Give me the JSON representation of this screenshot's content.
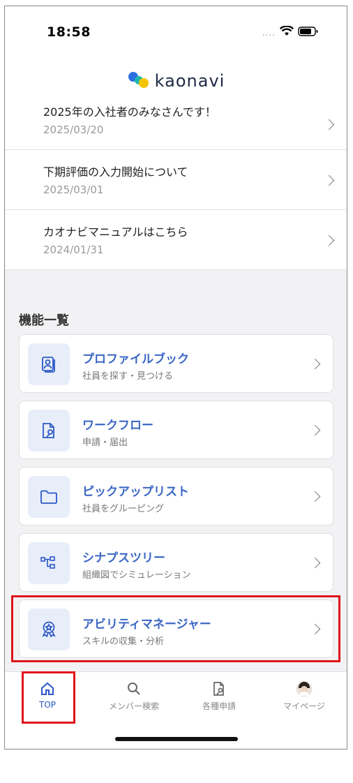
{
  "status_bar": {
    "time": "18:58",
    "signal": "....",
    "wifi_icon": "wifi-icon",
    "battery_icon": "battery-icon"
  },
  "header": {
    "logo_text": "kaonavi"
  },
  "news": [
    {
      "title": "2025年の入社者のみなさんです！",
      "date": "2025/03/20"
    },
    {
      "title": "下期評価の入力開始について",
      "date": "2025/03/01"
    },
    {
      "title": "カオナビマニュアルはこちら",
      "date": "2024/01/31"
    }
  ],
  "features": {
    "section_title": "機能一覧",
    "items": [
      {
        "title": "プロファイルブック",
        "subtitle": "社員を探す・見つける",
        "icon": "profile-book-icon"
      },
      {
        "title": "ワークフロー",
        "subtitle": "申請・届出",
        "icon": "workflow-icon"
      },
      {
        "title": "ピックアップリスト",
        "subtitle": "社員をグルーピング",
        "icon": "folder-icon"
      },
      {
        "title": "シナプスツリー",
        "subtitle": "組織図でシミュレーション",
        "icon": "org-tree-icon"
      },
      {
        "title": "アビリティマネージャー",
        "subtitle": "スキルの収集・分析",
        "icon": "ability-badge-icon"
      }
    ]
  },
  "tabbar": {
    "tabs": [
      {
        "label": "TOP",
        "icon": "home-icon",
        "active": true
      },
      {
        "label": "メンバー検索",
        "icon": "search-icon",
        "active": false
      },
      {
        "label": "各種申請",
        "icon": "application-icon",
        "active": false
      },
      {
        "label": "マイページ",
        "icon": "avatar",
        "active": false
      }
    ]
  },
  "colors": {
    "accent": "#3a66c4",
    "highlight": "#e0131b",
    "section_bg": "#f2f2f4"
  }
}
